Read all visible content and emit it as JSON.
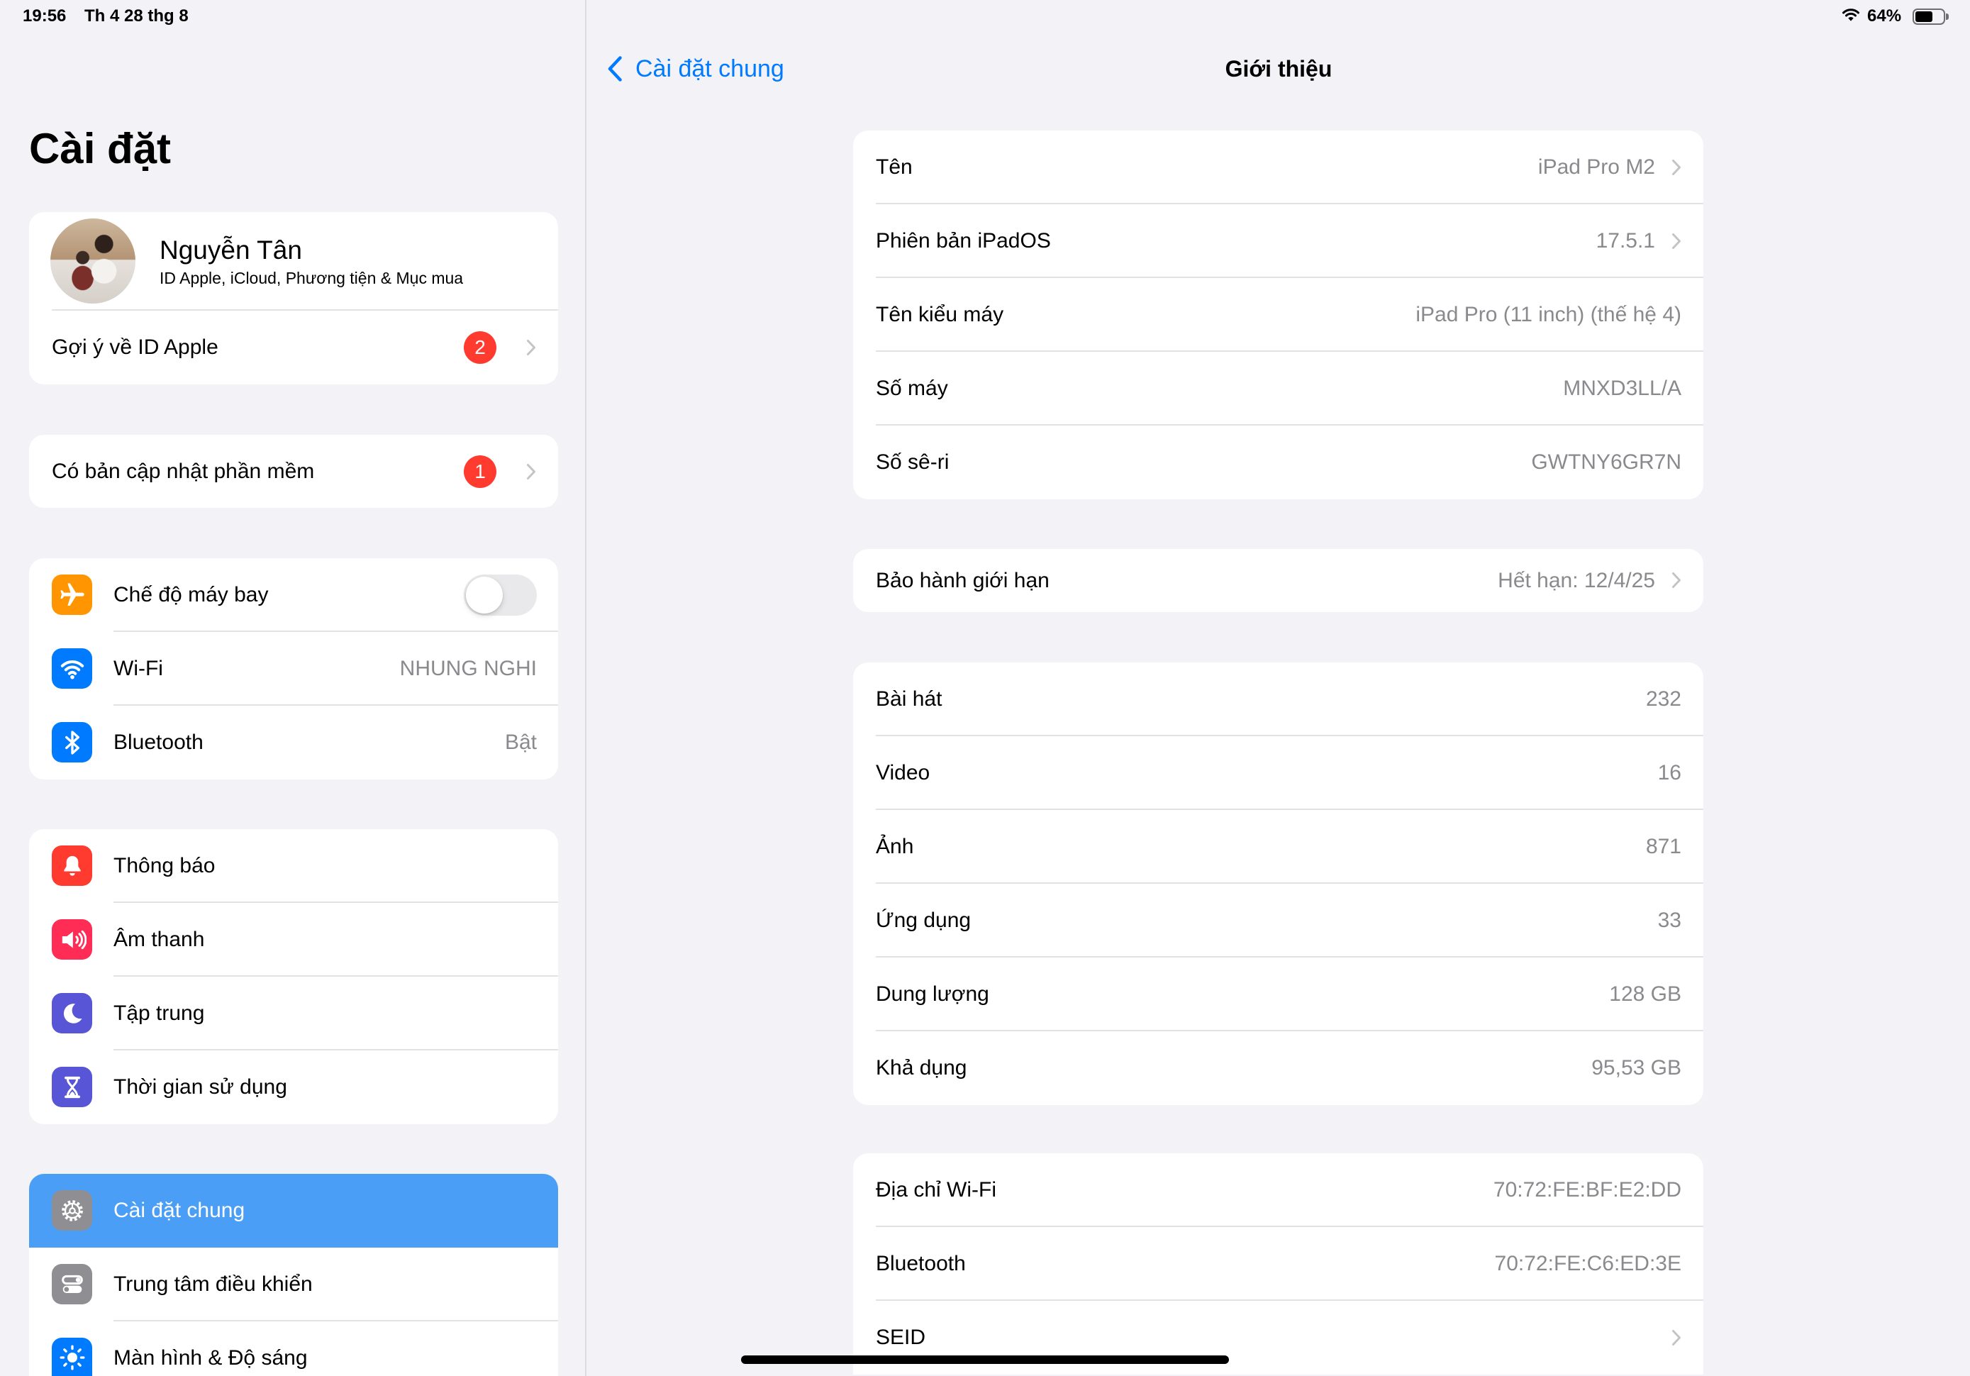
{
  "status_bar": {
    "time": "19:56",
    "date": "Th 4 28 thg 8",
    "battery_label": "64%",
    "battery_level": 0.64,
    "wifi_icon": "wifi-icon",
    "battery_icon": "battery-icon"
  },
  "colors": {
    "accent": "#007aff",
    "badge": "#ff3b30",
    "selection": "#4b9ef5",
    "background": "#f2f2f7"
  },
  "sidebar": {
    "title": "Cài đặt",
    "profile": {
      "name": "Nguyễn Tân",
      "subtitle": "ID Apple, iCloud, Phương tiện & Mục mua",
      "suggestion_label": "Gợi ý về ID Apple",
      "suggestion_badge": "2"
    },
    "update": {
      "label": "Có bản cập nhật phần mềm",
      "badge": "1"
    },
    "connectivity": [
      {
        "label": "Chế độ máy bay",
        "icon": "airplane-icon",
        "color": "#ff9500",
        "toggle_on": false
      },
      {
        "label": "Wi-Fi",
        "value": "NHUNG NGHI",
        "icon": "wifi-icon",
        "color": "#007aff"
      },
      {
        "label": "Bluetooth",
        "value": "Bật",
        "icon": "bluetooth-icon",
        "color": "#007aff"
      }
    ],
    "alerts": [
      {
        "label": "Thông báo",
        "icon": "bell-icon",
        "color": "#ff3b30"
      },
      {
        "label": "Âm thanh",
        "icon": "speaker-icon",
        "color": "#ff2d55"
      },
      {
        "label": "Tập trung",
        "icon": "moon-icon",
        "color": "#5856d6"
      },
      {
        "label": "Thời gian sử dụng",
        "icon": "hourglass-icon",
        "color": "#5856d6"
      }
    ],
    "general": [
      {
        "label": "Cài đặt chung",
        "icon": "gear-icon",
        "color": "#8e8e93",
        "selected": true
      },
      {
        "label": "Trung tâm điều khiển",
        "icon": "control-center-icon",
        "color": "#8e8e93"
      },
      {
        "label": "Màn hình & Độ sáng",
        "icon": "sun-icon",
        "color": "#007aff"
      }
    ]
  },
  "detail": {
    "back_label": "Cài đặt chung",
    "title": "Giới thiệu",
    "device": [
      {
        "label": "Tên",
        "value": "iPad Pro M2",
        "chevron": true
      },
      {
        "label": "Phiên bản iPadOS",
        "value": "17.5.1",
        "chevron": true
      },
      {
        "label": "Tên kiểu máy",
        "value": "iPad Pro (11 inch) (thế hệ 4)"
      },
      {
        "label": "Số máy",
        "value": "MNXD3LL/A"
      },
      {
        "label": "Số sê-ri",
        "value": "GWTNY6GR7N"
      }
    ],
    "warranty": [
      {
        "label": "Bảo hành giới hạn",
        "value": "Hết hạn: 12/4/25",
        "chevron": true
      }
    ],
    "media": [
      {
        "label": "Bài hát",
        "value": "232"
      },
      {
        "label": "Video",
        "value": "16"
      },
      {
        "label": "Ảnh",
        "value": "871"
      },
      {
        "label": "Ứng dụng",
        "value": "33"
      },
      {
        "label": "Dung lượng",
        "value": "128 GB"
      },
      {
        "label": "Khả dụng",
        "value": "95,53 GB"
      }
    ],
    "network": [
      {
        "label": "Địa chỉ Wi-Fi",
        "value": "70:72:FE:BF:E2:DD"
      },
      {
        "label": "Bluetooth",
        "value": "70:72:FE:C6:ED:3E"
      },
      {
        "label": "SEID",
        "chevron": true
      }
    ]
  }
}
